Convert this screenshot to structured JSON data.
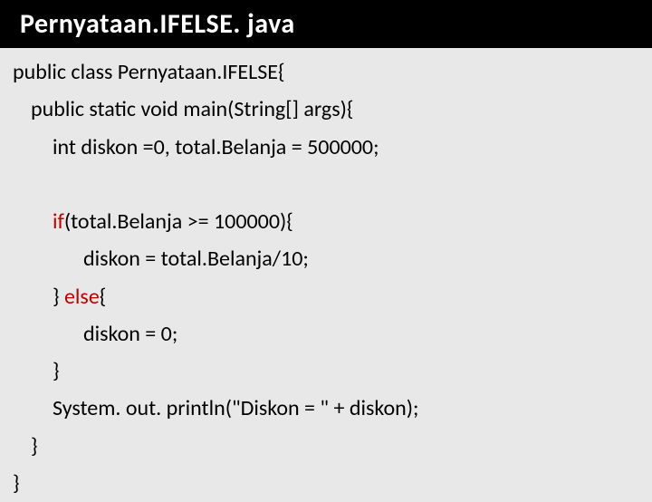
{
  "title": "Pernyataan.IFELSE. java",
  "code": {
    "l1": "public class Pernyataan.IFELSE{",
    "l2": "public static void main(String[] args){",
    "l3": "int diskon =0, total.Belanja = 500000;",
    "l4_kw": "if",
    "l4_rest": "(total.Belanja >= 100000){",
    "l5": "diskon = total.Belanja/10;",
    "l6_a": "} ",
    "l6_kw": "else",
    "l6_b": "{",
    "l7": "diskon = 0;",
    "l8": "}",
    "l9": "System. out. println(\"Diskon = \" + diskon);",
    "l10": "}",
    "l11": "}"
  }
}
